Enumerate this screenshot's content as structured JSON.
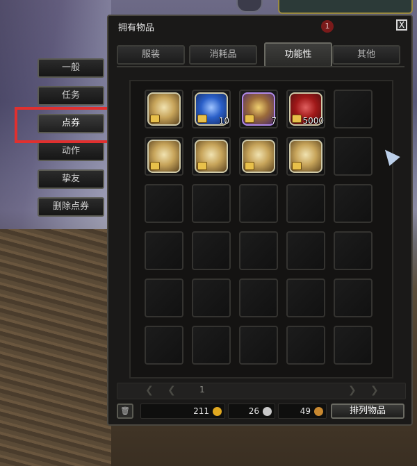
{
  "window": {
    "title": "拥有物品",
    "badge": "1",
    "close_label": "X"
  },
  "side_tabs": [
    {
      "label": "一般"
    },
    {
      "label": "任务"
    },
    {
      "label": "点券",
      "active": true
    },
    {
      "label": "动作"
    },
    {
      "label": "挚友"
    },
    {
      "label": "删除点券"
    }
  ],
  "tabs": [
    {
      "label": "服装"
    },
    {
      "label": "消耗品"
    },
    {
      "label": "功能性",
      "active": true
    },
    {
      "label": "其他"
    }
  ],
  "grid": {
    "columns": 5,
    "rows": 6,
    "items": [
      {
        "slot": 0,
        "icon": "bag-icon",
        "count": ""
      },
      {
        "slot": 1,
        "icon": "ticket-icon",
        "count": "10"
      },
      {
        "slot": 2,
        "icon": "mask-icon",
        "count": "7"
      },
      {
        "slot": 3,
        "icon": "coin-icon",
        "count": "5000"
      },
      {
        "slot": 5,
        "icon": "bag-icon",
        "count": ""
      },
      {
        "slot": 6,
        "icon": "bag-icon",
        "count": ""
      },
      {
        "slot": 7,
        "icon": "bag-icon",
        "count": ""
      },
      {
        "slot": 8,
        "icon": "bag-icon",
        "count": ""
      }
    ]
  },
  "pager": {
    "page": "1"
  },
  "currency": [
    {
      "value": "211",
      "icon": "gold-coin-icon",
      "color": "#e0a820"
    },
    {
      "value": "26",
      "icon": "silver-coin-icon",
      "color": "#c8c8c8"
    },
    {
      "value": "49",
      "icon": "bronze-coin-icon",
      "color": "#c88830"
    }
  ],
  "sort_label": "排列物品",
  "colors": {
    "highlight": "#e0302f",
    "panel": "#1a1918"
  }
}
